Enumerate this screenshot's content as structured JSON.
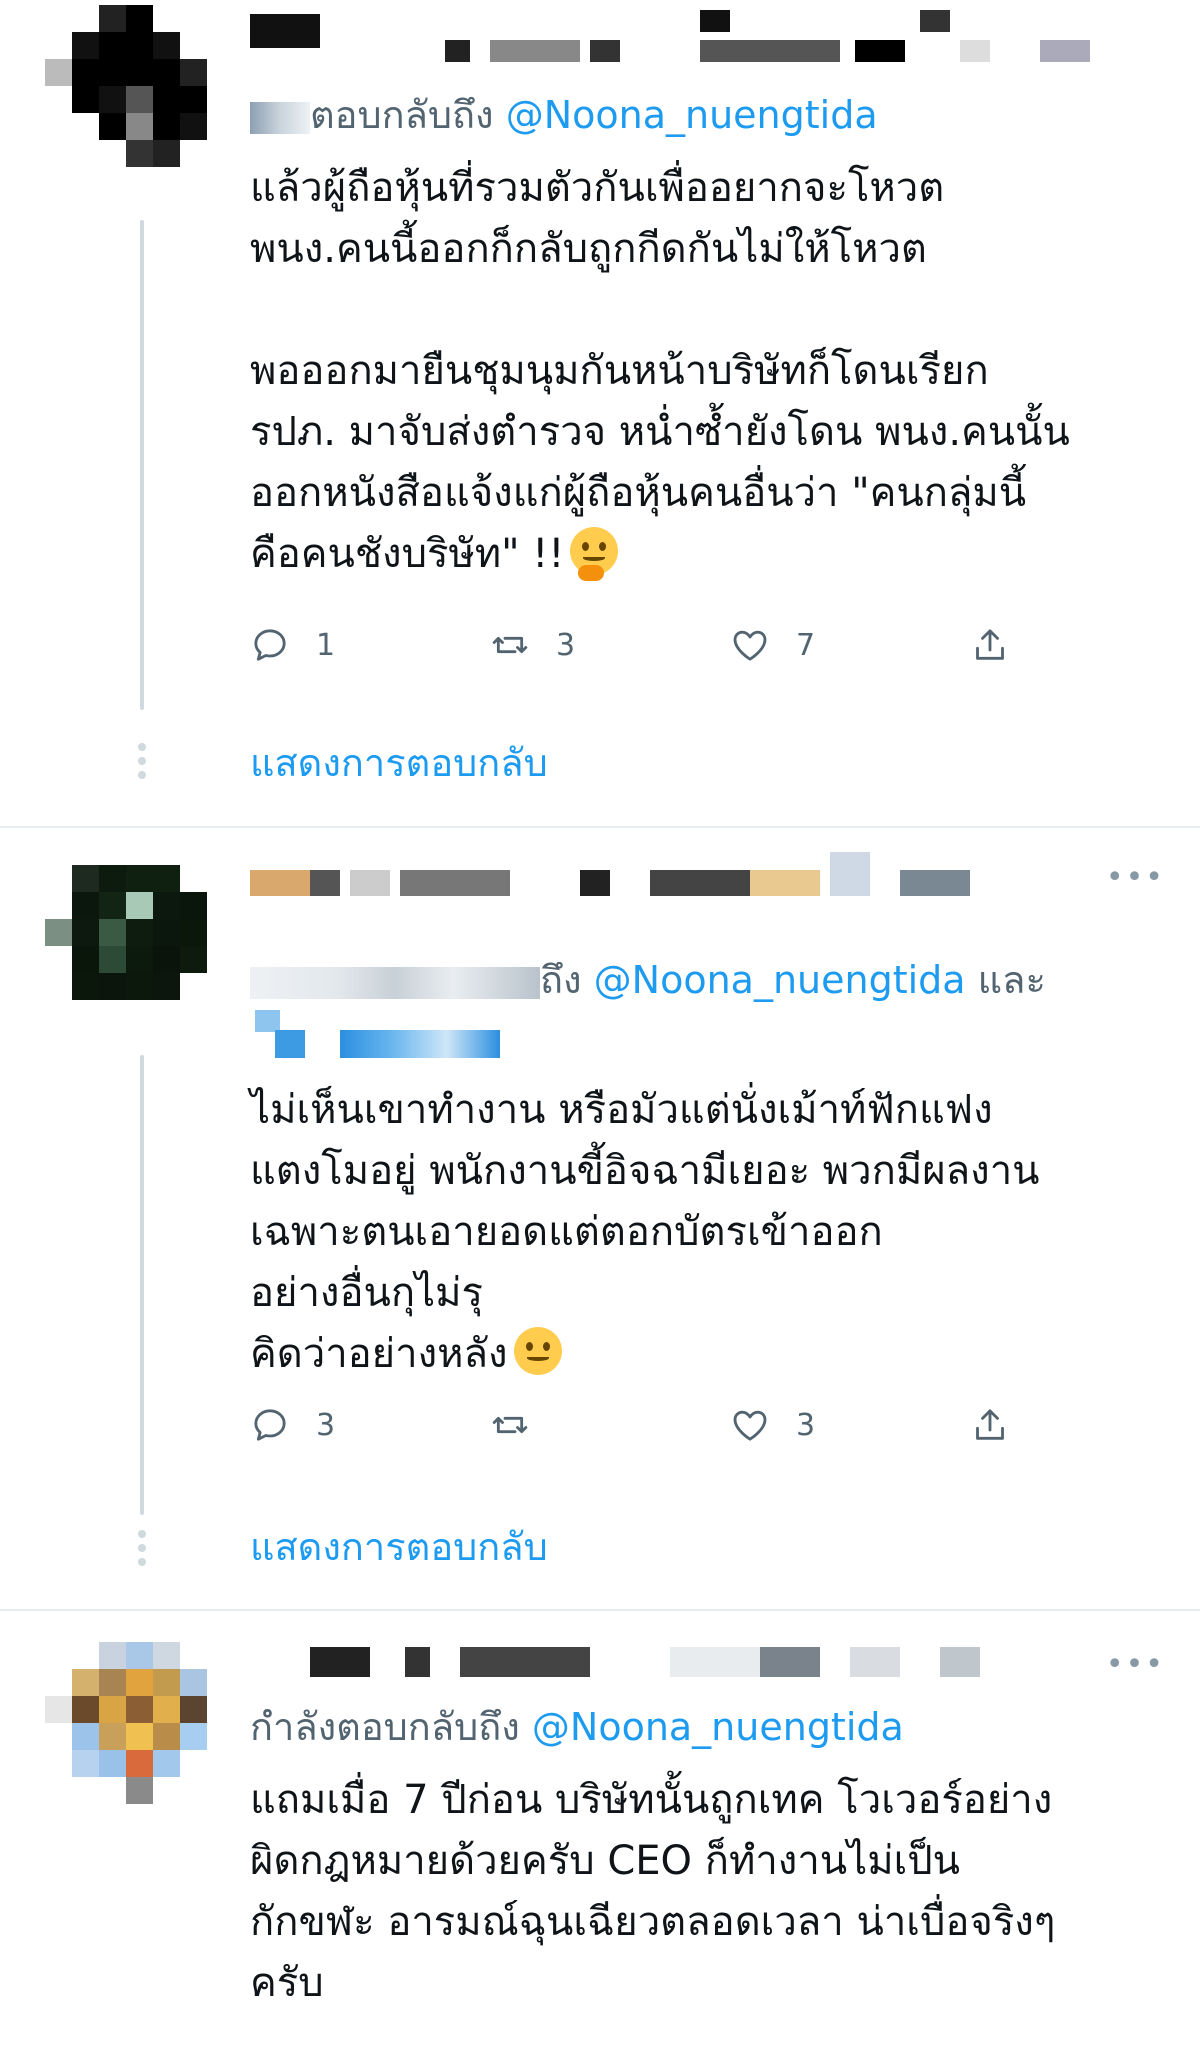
{
  "tweets": [
    {
      "reply_prefix": "ตอบกลับถึง",
      "handle": "@Noona_nuengtida",
      "handle_suffix": "",
      "body": "แล้วผู้ถือหุ้นที่รวมตัวกันเพื่ออยากจะโหวต\nพนง.คนนี้ออกก็กลับถูกกีดกันไม่ให้โหวต\n\nพอออกมายืนชุมนุมกันหน้าบริษัทก็โดนเรียก\nรปภ. มาจับส่งตำรวจ หน่ำซ้ำยังโดน พนง.คนนั้น\nออกหนังสือแจ้งแก่ผู้ถือหุ้นคนอื่นว่า \"คนกลุ่มนี้\nคือคนชังบริษัท\" !!",
      "emoji": "thinking-face-emoji",
      "replies": "1",
      "retweets": "3",
      "likes": "7",
      "show_replies": "แสดงการตอบกลับ"
    },
    {
      "reply_prefix": "ถึง",
      "handle": "@Noona_nuengtida",
      "handle_suffix": "และ",
      "body": "ไม่เห็นเขาทำงาน หรือมัวแต่นั่งเม้าท์ฟักแฟง\nแตงโมอยู่ พนักงานขี้อิจฉามีเยอะ พวกมีผลงาน\nเฉพาะตนเอายอดแต่ตอกบัตรเข้าออก\nอย่างอื่นกุไม่รุ\nคิดว่าอย่างหลัง",
      "emoji": "smirking-face-emoji",
      "replies": "3",
      "retweets": "",
      "likes": "3",
      "show_replies": "แสดงการตอบกลับ",
      "more": "•••"
    },
    {
      "reply_prefix": "กำลังตอบกลับถึง",
      "handle": "@Noona_nuengtida",
      "handle_suffix": "",
      "body": "แถมเมื่อ 7 ปีก่อน บริษัทนั้นถูกเทค โวเวอร์อย่าง\nผิดกฎหมายด้วยครับ CEO ก็ทำงานไม่เป็น\nกักขฬะ อารมณ์ฉุนเฉียวตลอดเวลา น่าเบื่อจริงๆ\nครับ",
      "more": "•••"
    }
  ],
  "colors": {
    "link": "#1d9bf0",
    "muted": "#536471",
    "divider": "#e6ecf0"
  }
}
